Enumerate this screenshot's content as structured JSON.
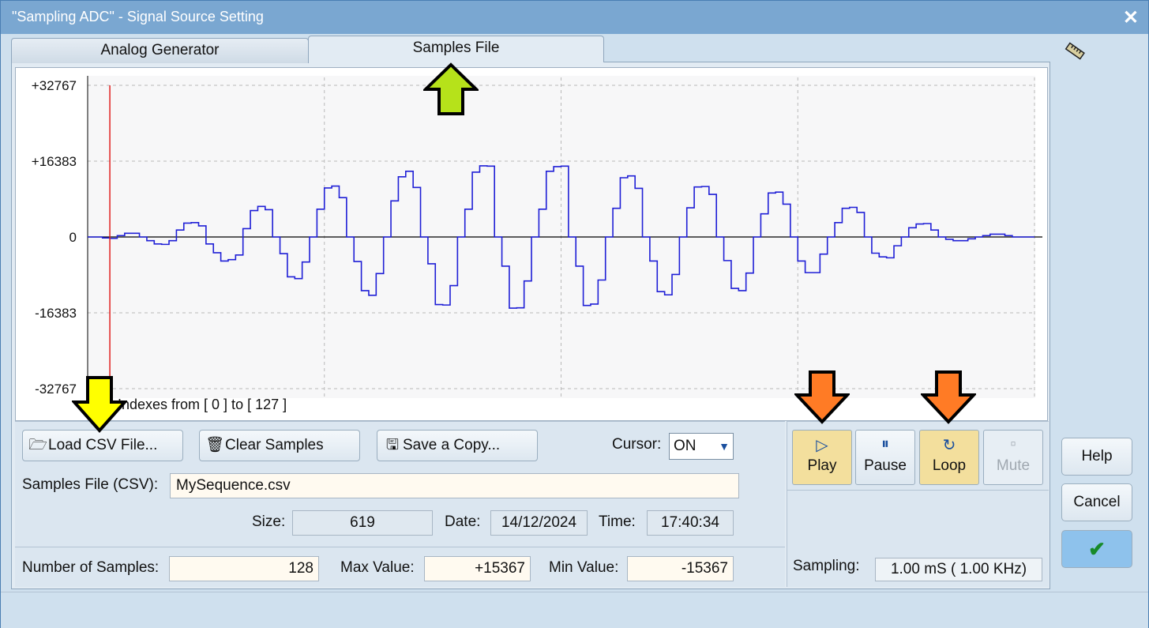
{
  "window": {
    "title": "\"Sampling ADC\" -  Signal Source Setting",
    "close": "✕"
  },
  "tabs": [
    {
      "label": "Analog Generator"
    },
    {
      "label": "Samples File"
    }
  ],
  "chart_data": {
    "type": "line",
    "ytick_labels": [
      "+32767",
      "+16383",
      "0",
      "-16383",
      "-32767"
    ],
    "yticks": [
      32767,
      16383,
      0,
      -16383,
      -32767
    ],
    "ylim": [
      -32767,
      32767
    ],
    "xlim": [
      0,
      127
    ],
    "grid": true,
    "x_range_caption": "Indexes from [ 0 ]  to  [ 127 ]",
    "cursor_index": 3,
    "series": [
      {
        "values": [
          0,
          0,
          -200,
          -300,
          300,
          800,
          800,
          0,
          -800,
          -1500,
          -1600,
          -800,
          1500,
          3000,
          3100,
          2400,
          -1500,
          -3400,
          -5200,
          -4900,
          -3900,
          1800,
          5700,
          6600,
          5900,
          0,
          -3600,
          -8600,
          -9000,
          -5400,
          0,
          6000,
          10600,
          11000,
          8500,
          0,
          -5300,
          -11600,
          -12600,
          -7900,
          0,
          7800,
          13000,
          14200,
          10700,
          0,
          -5800,
          -14600,
          -14700,
          -10500,
          0,
          6000,
          14000,
          15367,
          15300,
          0,
          -6300,
          -15367,
          -15300,
          -9500,
          0,
          6000,
          14200,
          15200,
          15300,
          0,
          -6300,
          -14800,
          -14500,
          -9300,
          0,
          6200,
          12800,
          13200,
          10500,
          0,
          -5200,
          -11800,
          -12500,
          -8100,
          0,
          6300,
          10800,
          10900,
          9200,
          0,
          -5100,
          -11100,
          -11600,
          -7800,
          0,
          5000,
          9500,
          9700,
          7100,
          0,
          -5200,
          -7700,
          -7700,
          -3700,
          0,
          3100,
          6200,
          6400,
          5300,
          0,
          -3500,
          -4300,
          -4500,
          -1900,
          0,
          2000,
          2800,
          2900,
          1500,
          0,
          -500,
          -800,
          -800,
          -400,
          0,
          300,
          600,
          600,
          300,
          0,
          0,
          0
        ]
      }
    ]
  },
  "buttons": {
    "load": "Load CSV File...",
    "clear": "Clear Samples",
    "save": "Save a Copy..."
  },
  "cursor": {
    "label": "Cursor:",
    "value": "ON"
  },
  "file": {
    "label": "Samples File (CSV):",
    "value": "MySequence.csv"
  },
  "info": {
    "size_label": "Size:",
    "size": "619",
    "date_label": "Date:",
    "date": "14/12/2024",
    "time_label": "Time:",
    "time": "17:40:34"
  },
  "stats": {
    "num_label": "Number of Samples:",
    "num": "128",
    "max_label": "Max Value:",
    "max": "+15367",
    "min_label": "Min Value:",
    "min": "-15367"
  },
  "transport": {
    "play": "Play",
    "pause": "Pause",
    "loop": "Loop",
    "mute": "Mute"
  },
  "sampling": {
    "label": "Sampling:",
    "value": "1.00 mS (  1.00 KHz)"
  },
  "side": {
    "help": "Help",
    "cancel": "Cancel",
    "ok": "✔"
  },
  "colors": {
    "accent_on": "#f3df9d",
    "trace": "#1f1fd6",
    "cursor": "#e02020",
    "arrow_yellow": "#ffff00",
    "arrow_green": "#b6e21a",
    "arrow_orange": "#ff7b25"
  }
}
